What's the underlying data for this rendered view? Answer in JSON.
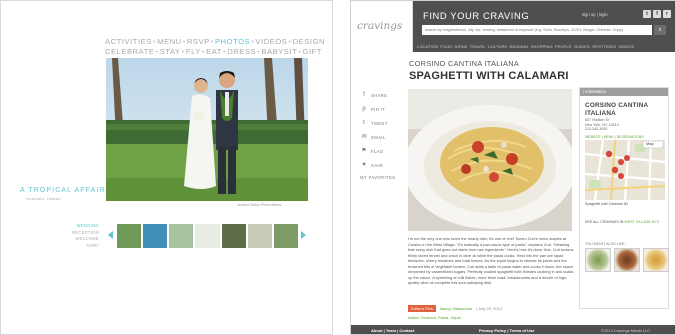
{
  "wedding": {
    "nav_row1": [
      {
        "label": "ACTIVITIES",
        "active": false
      },
      {
        "label": "MENU",
        "active": false
      },
      {
        "label": "RSVP",
        "active": false
      },
      {
        "label": "PHOTOS",
        "active": true
      },
      {
        "label": "VIDEOS",
        "active": false
      },
      {
        "label": "DESIGN",
        "active": false
      }
    ],
    "nav_row2": [
      {
        "label": "CELEBRATE",
        "active": false
      },
      {
        "label": "STAY",
        "active": false
      },
      {
        "label": "FLY",
        "active": false
      },
      {
        "label": "EAT",
        "active": false
      },
      {
        "label": "DRESS",
        "active": false
      },
      {
        "label": "BABYSIT",
        "active": false
      },
      {
        "label": "GIFT",
        "active": false
      }
    ],
    "separator": "•",
    "site_title": "A TROPICAL AFFAIR",
    "site_subtitle": "Honolulu, Hawaii",
    "photo_credit": "Jessica Walsh Photo Affairs",
    "side_menu": [
      {
        "label": "WEDDING",
        "active": true
      },
      {
        "label": "RECEPTION",
        "active": false
      },
      {
        "label": "WELCOME",
        "active": false
      },
      {
        "label": "TAPE!",
        "active": false
      }
    ],
    "thumb_colors": [
      "#6f9a5a",
      "#3f8fb8",
      "#a8c3a0",
      "#e8ede4",
      "#5e6e4a",
      "#c9cdb8",
      "#7e9a66"
    ]
  },
  "cravings": {
    "logo": "cravings",
    "find_title": "FIND YOUR CRAVING",
    "signup": "sign up  |  login",
    "social": [
      {
        "name": "twitter-icon",
        "glyph": "t"
      },
      {
        "name": "facebook-icon",
        "glyph": "f"
      },
      {
        "name": "rss-icon",
        "glyph": "r"
      }
    ],
    "search_placeholder": "search by neighborhood, city, zip, craving, restaurant or keyword (e.g. Soho, Brooklyn, 11201, Burger, Chinese, Cupp)",
    "categories": [
      "LOCATION",
      "FOOD",
      "DRINK",
      "TRAVEL",
      "CULTURE",
      "READING",
      "SHOPPING",
      "PEOPLE",
      "GUIDES",
      "SPOTTINGS",
      "VIDEOS"
    ],
    "restaurant": "CORSINO CANTINA ITALIANA",
    "dish": "SPAGHETTI WITH CALAMARI",
    "share": [
      {
        "icon": "facebook-icon",
        "glyph": "f",
        "label": "SHARE"
      },
      {
        "icon": "pinterest-icon",
        "glyph": "p",
        "label": "PIN IT"
      },
      {
        "icon": "twitter-icon",
        "glyph": "t",
        "label": "TWEET"
      },
      {
        "icon": "email-icon",
        "glyph": "✉",
        "label": "EMAIL"
      },
      {
        "icon": "flag-icon",
        "glyph": "⚑",
        "label": "FLAG"
      },
      {
        "icon": "heart-icon",
        "glyph": "♥",
        "label": "SAVE"
      }
    ],
    "my_favorites": "MY FAVORITES",
    "body": "I'm not the only one who loves the hearty dish; it's one of chef Tomeo Curi's menu staples at Corsino in the West Village. \"It's basically a pan-sauce type of pasta,\" explains Curi. \"Meaning that every dish that goes out starts from raw ingredients.\" Here's how it's done: first, Curi browns thinly sliced fennel and onion in olive oil while the pasta cooks. Heat into the pan are squid tentacles, cherry tomatoes and basil leaves. As the squid begins to release its juices and the browned bits of vegetable loosen, Curi adds a ladle of pasta water and cooks it down, the sauce deepened by caramelized sugars. Perfectly cooked spaghetti both finishes cooking in and soaks up the sauce. A sprinkling of chili flakes, more fresh basil, breadcrumbs and a drizzle of high-quality olive oil complete this soul-satisfying dish.",
    "editors_pick": "Editor's Pick",
    "author": "Nancy Matsumoto",
    "date": "| July 20, 2012",
    "tags": "Italian, Seafood, Pasta, Squid",
    "info": {
      "header": "i Information",
      "name": "CORSINO CANTINA ITALIANA",
      "address": "637 Hudson St\nNew York, NY, 10014\n212-242-3093",
      "links": "WEBSITE | MENU | RESERVATIONS",
      "map_label": "Map",
      "map_caption": "Spaghetti with Calamari  $4",
      "see_all_prefix": "SEE ALL CRAVINGS IN ",
      "see_all_link": "WEST VILLAGE NYC",
      "might_like": "YOU MIGHT ALSO LIKE..."
    },
    "footer_left": "About  |  Team  |  Contact",
    "footer_mid": "Privacy Policy  |  Terms of Use",
    "footer_copy": "©2013 Cravings Media LLC"
  }
}
